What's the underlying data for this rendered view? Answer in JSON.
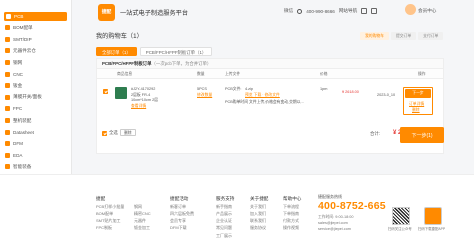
{
  "sidebar": {
    "items": [
      {
        "label": "PCB",
        "icon": "pcb-icon",
        "active": true
      },
      {
        "label": "BOM配单",
        "icon": "bom-icon"
      },
      {
        "label": "SMT/DIP",
        "icon": "smt-icon"
      },
      {
        "label": "元器件云仓",
        "icon": "components-icon"
      },
      {
        "label": "钢网",
        "icon": "stencil-icon"
      },
      {
        "label": "CNC",
        "icon": "cnc-icon"
      },
      {
        "label": "钣金",
        "icon": "sheet-metal-icon"
      },
      {
        "label": "薄膜开关/面板",
        "icon": "membrane-switch-icon"
      },
      {
        "label": "FPC",
        "icon": "fpc-icon"
      },
      {
        "label": "整机装配",
        "icon": "assembly-icon"
      },
      {
        "label": "Datasheet",
        "icon": "datasheet-icon"
      },
      {
        "label": "DFM",
        "icon": "dfm-icon"
      },
      {
        "label": "EDA",
        "icon": "eda-icon"
      },
      {
        "label": "智能装备",
        "icon": "equipment-icon"
      },
      {
        "label": "关于捷配",
        "icon": "about-icon"
      }
    ]
  },
  "header": {
    "logo_text": "捷配",
    "platform": "一站式电子制造服务平台",
    "links": [
      "微信",
      "400-990-8666",
      "网站导航"
    ],
    "user_name": "会员中心"
  },
  "cart": {
    "title": "我的购物车（1）",
    "steps": [
      "我的购物车",
      "提交订单",
      "支付订单"
    ],
    "tabs": [
      {
        "label": "全部订单（1）",
        "active": true
      },
      {
        "label": "PCB/FPC/HFPF制板订单（1）",
        "active": false
      }
    ],
    "section_title": "PCB/FPC/HFPF制板订单",
    "section_hint": "（一次pcb下单，为合并订单）",
    "columns": [
      "商品信息",
      "数量",
      "上传文件",
      "价格",
      "操作"
    ],
    "item": {
      "order_no": "#J2Y-4170292",
      "spec_line1": "2层板 FR-4",
      "spec_line2": "10cm*10cm 2层",
      "spec_link": "查看详情",
      "quantity": "5PCS",
      "quantity_link": "修改数量",
      "upload_label": "PCB文件:",
      "file_name": "4.zip",
      "file_actions": "预览 下载 · 修改文件",
      "notice": "PCB购单时间 文件上传,价格会有变动,交期以...",
      "discount": "1pm",
      "price": "¥ 2618.00",
      "delivery_date": "2023-0_10",
      "order_button": "下一步",
      "extra_link": "订单详情",
      "delete_link": "删除"
    },
    "select_all": "全选",
    "delete_button": "删除",
    "total_label": "合计:",
    "total_value": "¥ 2,618.00",
    "next_button": "下一步(1)"
  },
  "footer": {
    "columns": [
      {
        "head": "捷配",
        "items": [
          "PCB打样小批量",
          "BOM配单",
          "SMT贴片加工",
          "FPC制板"
        ]
      },
      {
        "head": "",
        "items": [
          "钢网",
          "精密CNC",
          "元器件",
          "钣金加工"
        ]
      },
      {
        "head": "捷配活动",
        "items": [
          "新客订单",
          "四六层板免费",
          "会员专享",
          "DFM下载"
        ]
      },
      {
        "head": "服务支持",
        "items": [
          "新手指南",
          "产品展示",
          "企业认证",
          "常见问题",
          "工厂展示"
        ]
      },
      {
        "head": "关于捷配",
        "items": [
          "关于我们",
          "加入我们",
          "联系我们",
          "服务协议"
        ]
      },
      {
        "head": "帮助中心",
        "items": [
          "下单流程",
          "下单指南",
          "付款方式",
          "操作视频"
        ]
      }
    ],
    "hotline_label": "捷配服务热线",
    "hotline": "400-8752-665",
    "contact_lines": [
      "工作时间: 9:00-18:00",
      "sales@jiepei.com",
      "service@jiepei.com"
    ],
    "qr_captions": [
      "扫码关注公众号",
      "扫码下载捷配APP"
    ]
  },
  "colors": {
    "accent": "#ff8a00",
    "price": "#e53935"
  }
}
